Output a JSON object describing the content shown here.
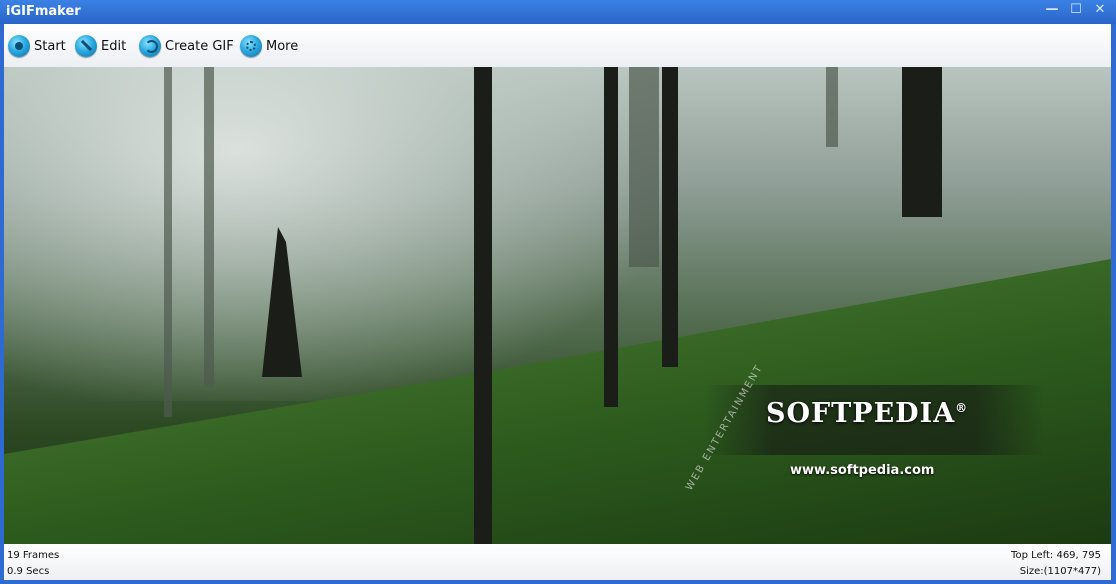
{
  "window": {
    "title": "iGIFmaker",
    "controls": {
      "minimize": "—",
      "maximize": "☐",
      "close": "✕"
    }
  },
  "toolbar": {
    "start": {
      "label": "Start",
      "icon": "start-icon"
    },
    "edit": {
      "label": "Edit",
      "icon": "edit-icon"
    },
    "create": {
      "label": "Create GIF",
      "icon": "create-gif-icon"
    },
    "more": {
      "label": "More",
      "icon": "more-icon"
    }
  },
  "preview": {
    "brand": "SOFTPEDIA",
    "brand_mark": "®",
    "site": "www.softpedia.com",
    "arc_text": "WEB ENTERTAINMENT"
  },
  "status": {
    "frames": "19 Frames",
    "duration": "0.9 Secs",
    "top_left": "Top Left: 469, 795",
    "size": "Size:(1107*477)"
  },
  "colors": {
    "titlebar": "#2e6ad1",
    "accent": "#2ba9df"
  }
}
